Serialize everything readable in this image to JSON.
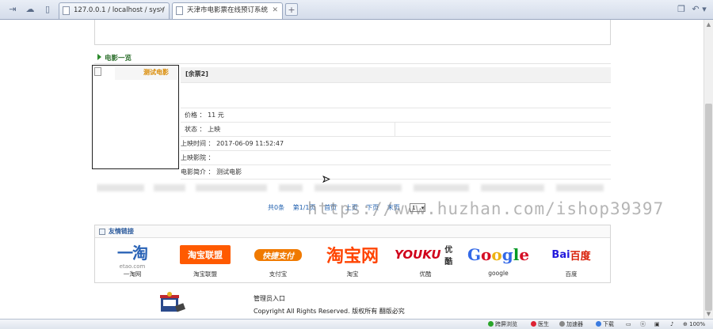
{
  "browser": {
    "tabs": [
      {
        "label": "127.0.0.1 / localhost / sys /",
        "active": false
      },
      {
        "label": "天津市电影票在线预订系统",
        "active": true
      }
    ],
    "new_tab": "+"
  },
  "movies_section": {
    "title": "电影一览",
    "poster_alt": "测试电影",
    "movie": {
      "name": "[余票2]",
      "price": "价格 ： 11 元",
      "status": "状态 ： 上映",
      "release_time": "上映时间 ： 2017-06-09 11:52:47",
      "cinema": "上映影院 ：",
      "intro": "电影简介 ： 测试电影"
    }
  },
  "pager": {
    "total": "共0条",
    "page_info": "第1/1页",
    "first": "首页",
    "prev": "上页",
    "next": "下页",
    "last": "末页",
    "page_select": "1"
  },
  "watermark": "https://www.huzhan.com/ishop39397",
  "links_section": {
    "title": "友情链接",
    "partners": [
      {
        "name": "一淘网",
        "logo": "一淘",
        "logo_sub": "etao.com"
      },
      {
        "name": "淘宝联盟",
        "logo": "淘宝联盟"
      },
      {
        "name": "支付宝",
        "logo": "快捷支付"
      },
      {
        "name": "淘宝",
        "logo": "淘宝网"
      },
      {
        "name": "优酷",
        "logo": "YOUKU",
        "logo_sub": "优酷"
      },
      {
        "name": "google",
        "logo": "Google"
      },
      {
        "name": "百度",
        "logo": "Bai",
        "logo_sub": "百度"
      }
    ]
  },
  "footer": {
    "admin_link": "管理员入口",
    "copyright": "Copyright All Rights Reserved. 版权所有  翻版必究"
  },
  "statusbar": {
    "items": [
      "跨屏浏览",
      "医生",
      "加速器",
      "下载",
      "100%"
    ]
  },
  "colors": {
    "section_title": "#2c6e2c",
    "link_blue": "#1f5fae",
    "poster_alt": "#d98900"
  }
}
